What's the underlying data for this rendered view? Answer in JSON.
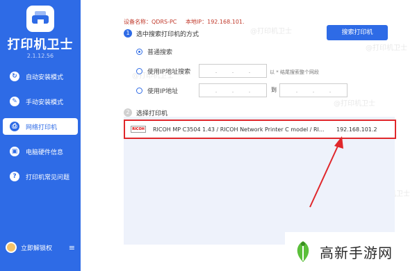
{
  "app": {
    "title": "打印机卫士",
    "version": "2.1.12.56"
  },
  "sidebar": {
    "items": [
      {
        "label": "自动安装模式",
        "icon": "install-icon",
        "active": false
      },
      {
        "label": "手动安装模式",
        "icon": "wrench-icon",
        "active": false
      },
      {
        "label": "网络打印机",
        "icon": "network-printer-icon",
        "active": true
      },
      {
        "label": "电脑硬件信息",
        "icon": "hardware-icon",
        "active": false
      },
      {
        "label": "打印机常见问题",
        "icon": "question-icon",
        "active": false
      }
    ],
    "user_label": "立即解锁权",
    "menu_icon": "menu-icon"
  },
  "device_info": {
    "device_name_label": "设备名称：QDRS-PC",
    "local_ip_label": "本地IP：192.168.101."
  },
  "step1": {
    "number": "1",
    "title": "选中搜索打印机的方式",
    "search_button": "搜索打印机",
    "options": [
      {
        "label": "普通搜索",
        "checked": true
      },
      {
        "label": "使用IP地址搜索",
        "checked": false,
        "hint": "以 * 结尾搜索整个网段"
      },
      {
        "label": "使用IP地址",
        "checked": false,
        "to_label": "到"
      }
    ]
  },
  "step2": {
    "number": "2",
    "title": "选择打印机"
  },
  "printers": [
    {
      "brand": "RICOH",
      "name": "RICOH MP C3504 1.43 / RICOH Network Printer C model / RI...",
      "ip": "192.168.101.2"
    }
  ],
  "watermark": "@打印机卫士",
  "brand_badge": "高新手游网",
  "colors": {
    "accent": "#2e6be6",
    "highlight": "#e0272b",
    "info_text": "#c0392b"
  }
}
